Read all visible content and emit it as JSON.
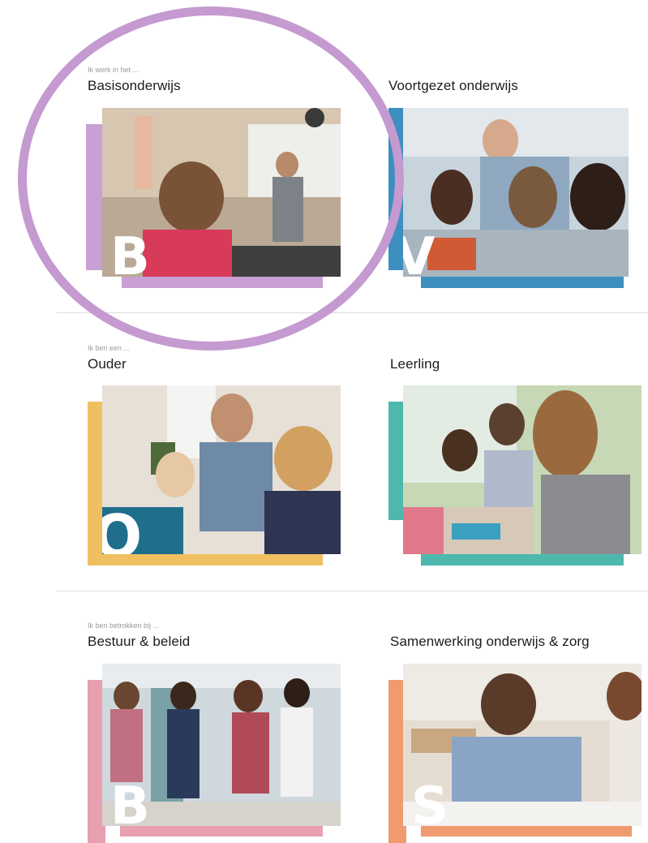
{
  "sections": [
    {
      "label": "Ik werk in het ...",
      "cards": [
        {
          "title": "Basisonderwijs",
          "letter": "B",
          "accent": "#c8a0d4"
        },
        {
          "title": "Voortgezet onderwijs",
          "letter": "V",
          "accent": "#3d8fbf"
        }
      ]
    },
    {
      "label": "Ik ben een ...",
      "cards": [
        {
          "title": "Ouder",
          "letter": "O",
          "accent": "#f0c060"
        },
        {
          "title": "Leerling",
          "letter": "",
          "accent": "#4fb8ad"
        }
      ]
    },
    {
      "label": "Ik ben betrokken bij ...",
      "cards": [
        {
          "title": "Bestuur & beleid",
          "letter": "B",
          "accent": "#e8a0b0"
        },
        {
          "title": "Samenwerking onderwijs & zorg",
          "letter": "S",
          "accent": "#f09a70"
        }
      ]
    }
  ],
  "highlight_color": "#c49ad0"
}
